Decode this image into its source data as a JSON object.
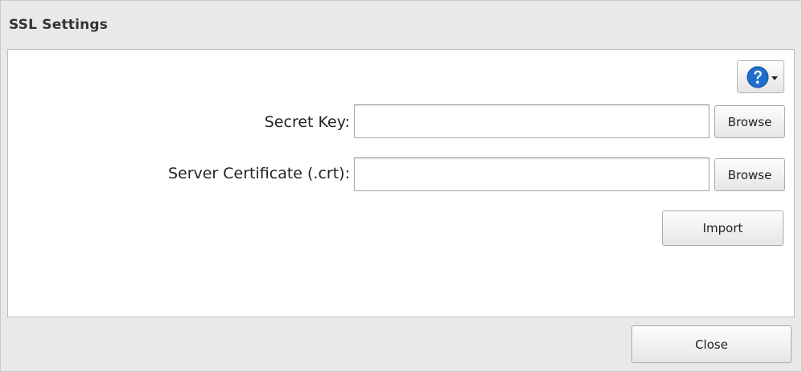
{
  "dialog": {
    "title": "SSL Settings",
    "help": {
      "icon": "help-icon",
      "dropdown_icon": "caret-down-icon",
      "accent": "#1e6fc9"
    },
    "fields": [
      {
        "label": "Secret Key:",
        "value": "",
        "browse_label": "Browse"
      },
      {
        "label": "Server Certificate (.crt):",
        "value": "",
        "browse_label": "Browse"
      }
    ],
    "import_label": "Import",
    "close_label": "Close"
  }
}
